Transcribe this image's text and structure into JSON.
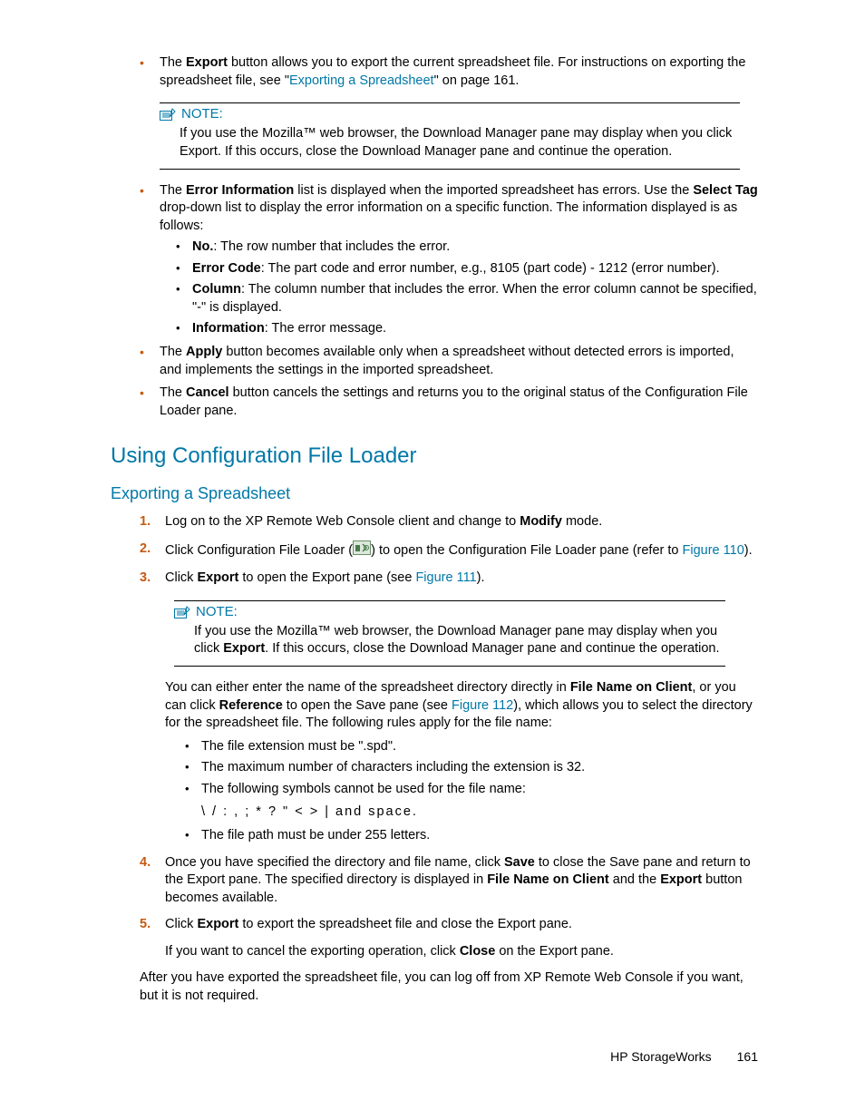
{
  "top": {
    "export_item": {
      "pre": "The ",
      "b1": "Export",
      "post1": " button allows you to export the current spreadsheet file.  For instructions on exporting the spreadsheet file, see \"",
      "link": "Exporting a Spreadsheet",
      "post2": "\" on page 161."
    },
    "note": {
      "label": "NOTE:",
      "body": "If you use the Mozilla™ web browser, the Download Manager pane may display when you click Export.  If this occurs, close the Download Manager pane and continue the operation."
    },
    "errorinfo": {
      "pre": "The ",
      "b1": "Error Information",
      "mid": " list is displayed when the imported spreadsheet has errors.  Use the ",
      "b2": "Select Tag",
      "post": " drop-down list to display the error information on a specific function.  The information displayed is as follows:",
      "sub": {
        "no_b": "No.",
        "no_t": ":  The row number that includes the error.",
        "ec_b": "Error Code",
        "ec_t": ":  The part code and error number, e.g., 8105 (part code) - 1212 (error number).",
        "col_b": "Column",
        "col_t": ":  The column number that includes the error.  When the error column cannot be specified, \"-\" is displayed.",
        "inf_b": "Information",
        "inf_t": ":  The error message."
      }
    },
    "apply": {
      "pre": "The ",
      "b1": "Apply",
      "post": " button becomes available only when a spreadsheet without detected errors is imported, and implements the settings in the imported spreadsheet."
    },
    "cancel": {
      "pre": "The ",
      "b1": "Cancel",
      "post": " button cancels the settings and returns you to the original status of the Configuration File Loader pane."
    }
  },
  "h2": "Using Configuration File Loader",
  "h3": "Exporting a Spreadsheet",
  "steps": {
    "s1": {
      "pre": "Log on to the XP Remote Web Console client and change to ",
      "b": "Modify",
      "post": " mode."
    },
    "s2": {
      "pre": "Click Configuration File Loader (",
      "post1": ") to open the Configuration File Loader pane (refer to ",
      "link": "Figure 110",
      "post2": ")."
    },
    "s3": {
      "pre": "Click ",
      "b": "Export",
      "mid": " to open the Export pane (see ",
      "link": "Figure 111",
      "post": ")."
    },
    "note": {
      "label": "NOTE:",
      "body_pre": "If you use the Mozilla™ web browser, the Download Manager pane may display when you click ",
      "body_b": "Export",
      "body_post": ".  If this occurs, close the Download Manager pane and continue the operation."
    },
    "para": {
      "pre": "You can either enter the name of the spreadsheet directory directly in ",
      "b1": "File Name on Client",
      "mid1": ", or you can click ",
      "b2": "Reference",
      "mid2": " to open the Save pane (see ",
      "link": "Figure 112",
      "post": "), which allows you to select the directory for the spreadsheet file.  The following rules apply for the file name:"
    },
    "rules": {
      "r1": "The file extension must be \".spd\".",
      "r2": "The maximum number of characters including the extension is 32.",
      "r3": "The following symbols cannot be used for the file name:",
      "symbols": "\\ / : , ; * ? \" < > |  and space.",
      "r4": "The file path must be under 255 letters."
    },
    "s4": {
      "pre": "Once you have specified the directory and file name, click ",
      "b1": "Save",
      "mid1": " to close the Save pane and return to the Export pane.  The specified directory is displayed in ",
      "b2": "File Name on Client",
      "mid2": " and the ",
      "b3": "Export",
      "post": " button becomes available."
    },
    "s5": {
      "pre": "Click ",
      "b": "Export",
      "post": " to export the spreadsheet file and close the Export pane.",
      "extra_pre": "If you want to cancel the exporting operation, click ",
      "extra_b": "Close",
      "extra_post": " on the Export pane."
    }
  },
  "after": "After you have exported the spreadsheet file, you can log off from XP Remote Web Console if you want, but it is not required.",
  "footer": {
    "brand": "HP StorageWorks",
    "page": "161"
  }
}
